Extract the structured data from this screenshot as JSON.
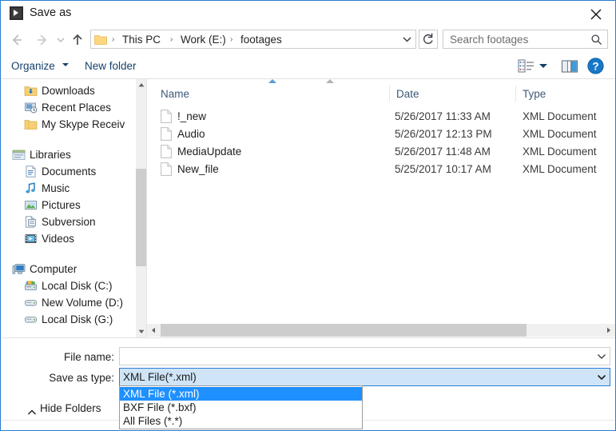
{
  "window": {
    "title": "Save as",
    "icon": "media-player-icon",
    "close_label": "✕",
    "accent_color": "#2a7fd4"
  },
  "navigation": {
    "back_tooltip": "Back",
    "forward_tooltip": "Forward",
    "recent_tooltip": "Recent locations",
    "up_tooltip": "Up",
    "refresh_tooltip": "Refresh",
    "breadcrumbs": [
      "This PC",
      "Work (E:)",
      "footages"
    ],
    "separator": "›"
  },
  "search": {
    "placeholder": "Search footages",
    "icon": "search-icon"
  },
  "commandbar": {
    "organize_label": "Organize",
    "new_folder_label": "New folder",
    "view_icon": "view-options-icon",
    "preview_pane_icon": "preview-pane-icon",
    "help_icon": "help-icon",
    "help_glyph": "?"
  },
  "navpane": {
    "items": [
      {
        "label": "Downloads",
        "icon": "downloads-folder-icon",
        "level": 1
      },
      {
        "label": "Recent Places",
        "icon": "recent-places-icon",
        "level": 1
      },
      {
        "label": "My Skype Receiv",
        "icon": "folder-icon",
        "level": 1
      },
      {
        "label": "Libraries",
        "icon": "libraries-icon",
        "level": 0
      },
      {
        "label": "Documents",
        "icon": "documents-icon",
        "level": 1
      },
      {
        "label": "Music",
        "icon": "music-icon",
        "level": 1
      },
      {
        "label": "Pictures",
        "icon": "pictures-icon",
        "level": 1
      },
      {
        "label": "Subversion",
        "icon": "subversion-icon",
        "level": 1
      },
      {
        "label": "Videos",
        "icon": "videos-icon",
        "level": 1
      },
      {
        "label": "Computer",
        "icon": "computer-icon",
        "level": 0
      },
      {
        "label": "Local Disk (C:)",
        "icon": "system-drive-icon",
        "level": 1
      },
      {
        "label": "New Volume (D:)",
        "icon": "drive-icon",
        "level": 1
      },
      {
        "label": "Local Disk (G:)",
        "icon": "drive-icon",
        "level": 1
      }
    ]
  },
  "filelist": {
    "columns": [
      "Name",
      "Date",
      "Type"
    ],
    "sort_indicator": "ascending",
    "rows": [
      {
        "name": "!_new",
        "date": "5/26/2017 11:33 AM",
        "type": "XML Document",
        "icon": "file-icon"
      },
      {
        "name": "Audio",
        "date": "5/26/2017 12:13 PM",
        "type": "XML Document",
        "icon": "file-icon"
      },
      {
        "name": "MediaUpdate",
        "date": "5/26/2017 11:48 AM",
        "type": "XML Document",
        "icon": "file-icon"
      },
      {
        "name": "New_file",
        "date": "5/25/2017 10:17 AM",
        "type": "XML Document",
        "icon": "file-icon"
      }
    ]
  },
  "form": {
    "filename_label": "File name:",
    "filename_value": "",
    "savetype_label": "Save as type:",
    "savetype_value": "XML File(*.xml)",
    "savetype_options": [
      "XML File (*.xml)",
      "BXF File (*.bxf)",
      "All Files (*.*)"
    ],
    "savetype_selected_index": 0,
    "hide_folders_label": "Hide Folders"
  }
}
